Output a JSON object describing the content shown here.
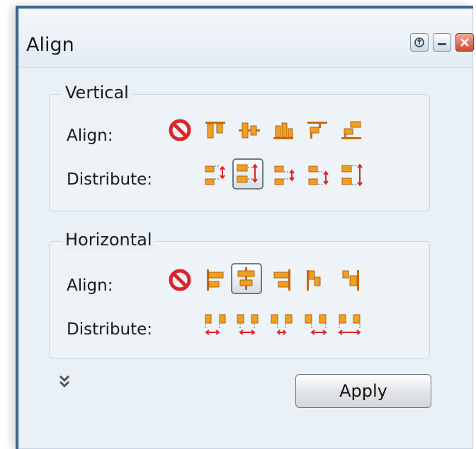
{
  "window": {
    "title": "Align",
    "buttons": [
      "restore-icon",
      "minimize-icon",
      "close-icon"
    ]
  },
  "vertical": {
    "group_title": "Vertical",
    "align_label": "Align:",
    "distribute_label": "Distribute:",
    "align_icons": [
      "none-icon",
      "align-top-icon",
      "align-middle-icon",
      "align-bottom-icon",
      "align-top-stairs-icon",
      "align-bottom-stairs-icon"
    ],
    "distribute_icons": [
      "distribute-top-icon",
      "distribute-center-icon",
      "distribute-gap-icon",
      "distribute-bottom-icon",
      "distribute-spread-icon"
    ],
    "selected_distribute": "distribute-center-icon"
  },
  "horizontal": {
    "group_title": "Horizontal",
    "align_label": "Align:",
    "distribute_label": "Distribute:",
    "align_icons": [
      "none-icon",
      "align-left-icon",
      "align-center-icon",
      "align-right-icon",
      "align-left-stairs-icon",
      "align-right-stairs-icon"
    ],
    "distribute_icons": [
      "distribute-left-icon",
      "distribute-hcenter-icon",
      "distribute-hgap-icon",
      "distribute-right-icon",
      "distribute-hspread-icon"
    ],
    "selected_align": "align-center-icon"
  },
  "footer": {
    "expand_icon": "double-chevron-down-icon",
    "apply_label": "Apply"
  },
  "colors": {
    "frame": "#3f668e",
    "panel": "#e9f0f6",
    "icon_orange": "#f0a020",
    "icon_red": "#d8262b"
  }
}
